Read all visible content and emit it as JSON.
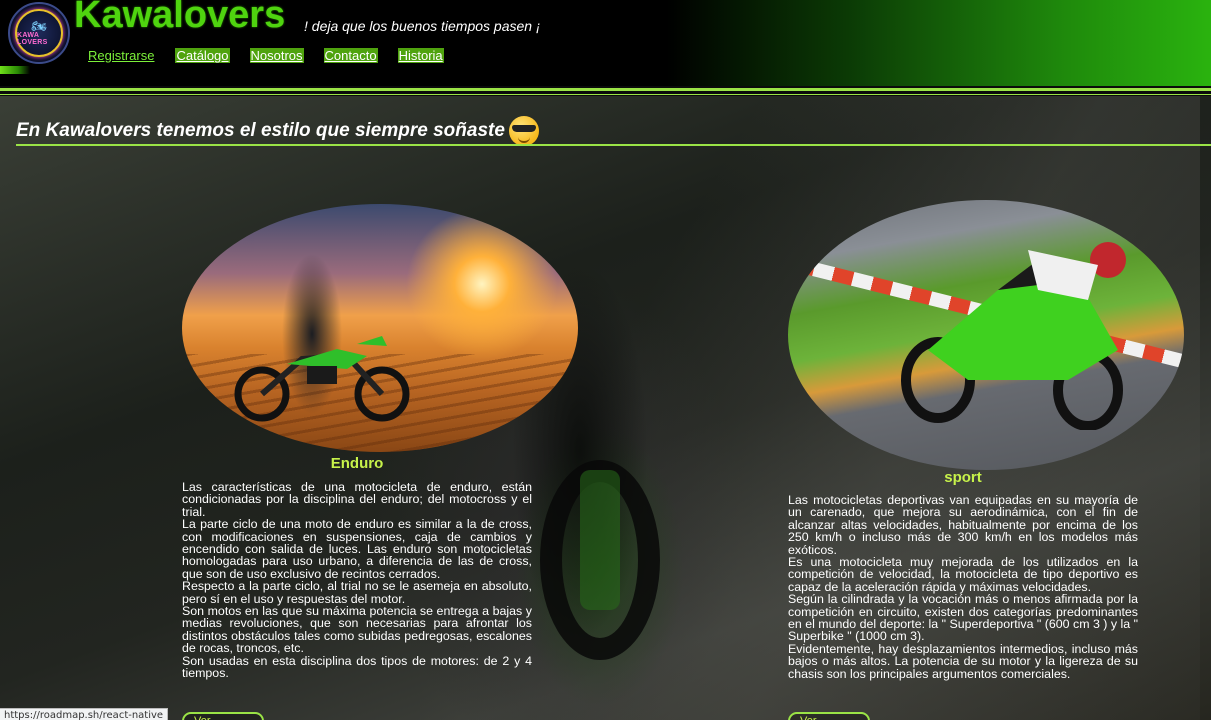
{
  "header": {
    "logo_text": "KAWA LOVERS",
    "brand": "Kawalovers",
    "slogan": "! deja que los buenos tiempos pasen ¡",
    "nav": [
      {
        "label": "Registrarse"
      },
      {
        "label": "Catálogo"
      },
      {
        "label": "Nosotros"
      },
      {
        "label": "Contacto"
      },
      {
        "label": "Historia"
      }
    ]
  },
  "main": {
    "title": "En Kawalovers tenemos el estilo que siempre soñaste",
    "title_emoji": "smiling-face-with-sunglasses-icon"
  },
  "cards": [
    {
      "title": "Enduro",
      "paragraphs": [
        "Las características de una motocicleta de enduro, están condicionadas por la disciplina del enduro; del motocross y el trial.",
        "La parte ciclo de una moto de enduro es similar a la de cross, con modificaciones en suspensiones, caja de cambios y encendido con salida de luces. Las enduro son motocicletas homologadas para uso urbano, a diferencia de las de cross, que son de uso exclusivo de recintos cerrados.",
        "Respecto a la parte ciclo, al trial no se le asemeja en absoluto, pero sí en el uso y respuestas del motor.",
        "Son motos en las que su máxima potencia se entrega a bajas y medias revoluciones, que son necesarias para afrontar los distintos obstáculos tales como subidas pedregosas, escalones de rocas, troncos, etc.",
        "Son usadas en esta disciplina dos tipos de motores: de 2 y 4 tiempos."
      ],
      "button": "Ver Catálogo"
    },
    {
      "title": "sport",
      "paragraphs": [
        "Las motocicletas deportivas van equipadas en su mayoría de un carenado, que mejora su aerodinámica, con el fin de alcanzar altas velocidades, habitualmente por encima de los 250 km/h o incluso más de 300 km/h en los modelos más exóticos.",
        "Es una motocicleta muy mejorada de los utilizados en la competición de velocidad, la motocicleta de tipo deportivo es capaz de la aceleración rápida y máximas velocidades.",
        "Según la cilindrada y la vocación más o menos afirmada por la competición en circuito, existen dos categorías predominantes en el mundo del deporte: la \" Superdeportiva \" (600 cm 3 ) y la \" Superbike \" (1000 cm 3).",
        "Evidentemente, hay desplazamientos intermedios, incluso más bajos o más altos. La potencia de su motor y la ligereza de su chasis son los principales argumentos comerciales."
      ],
      "button": "Ver Catálogo"
    }
  ],
  "status_bar": {
    "url": "https://roadmap.sh/react-native"
  },
  "colors": {
    "accent": "#4fd40f",
    "line": "#9ae346",
    "card_title": "#c7f24a"
  }
}
